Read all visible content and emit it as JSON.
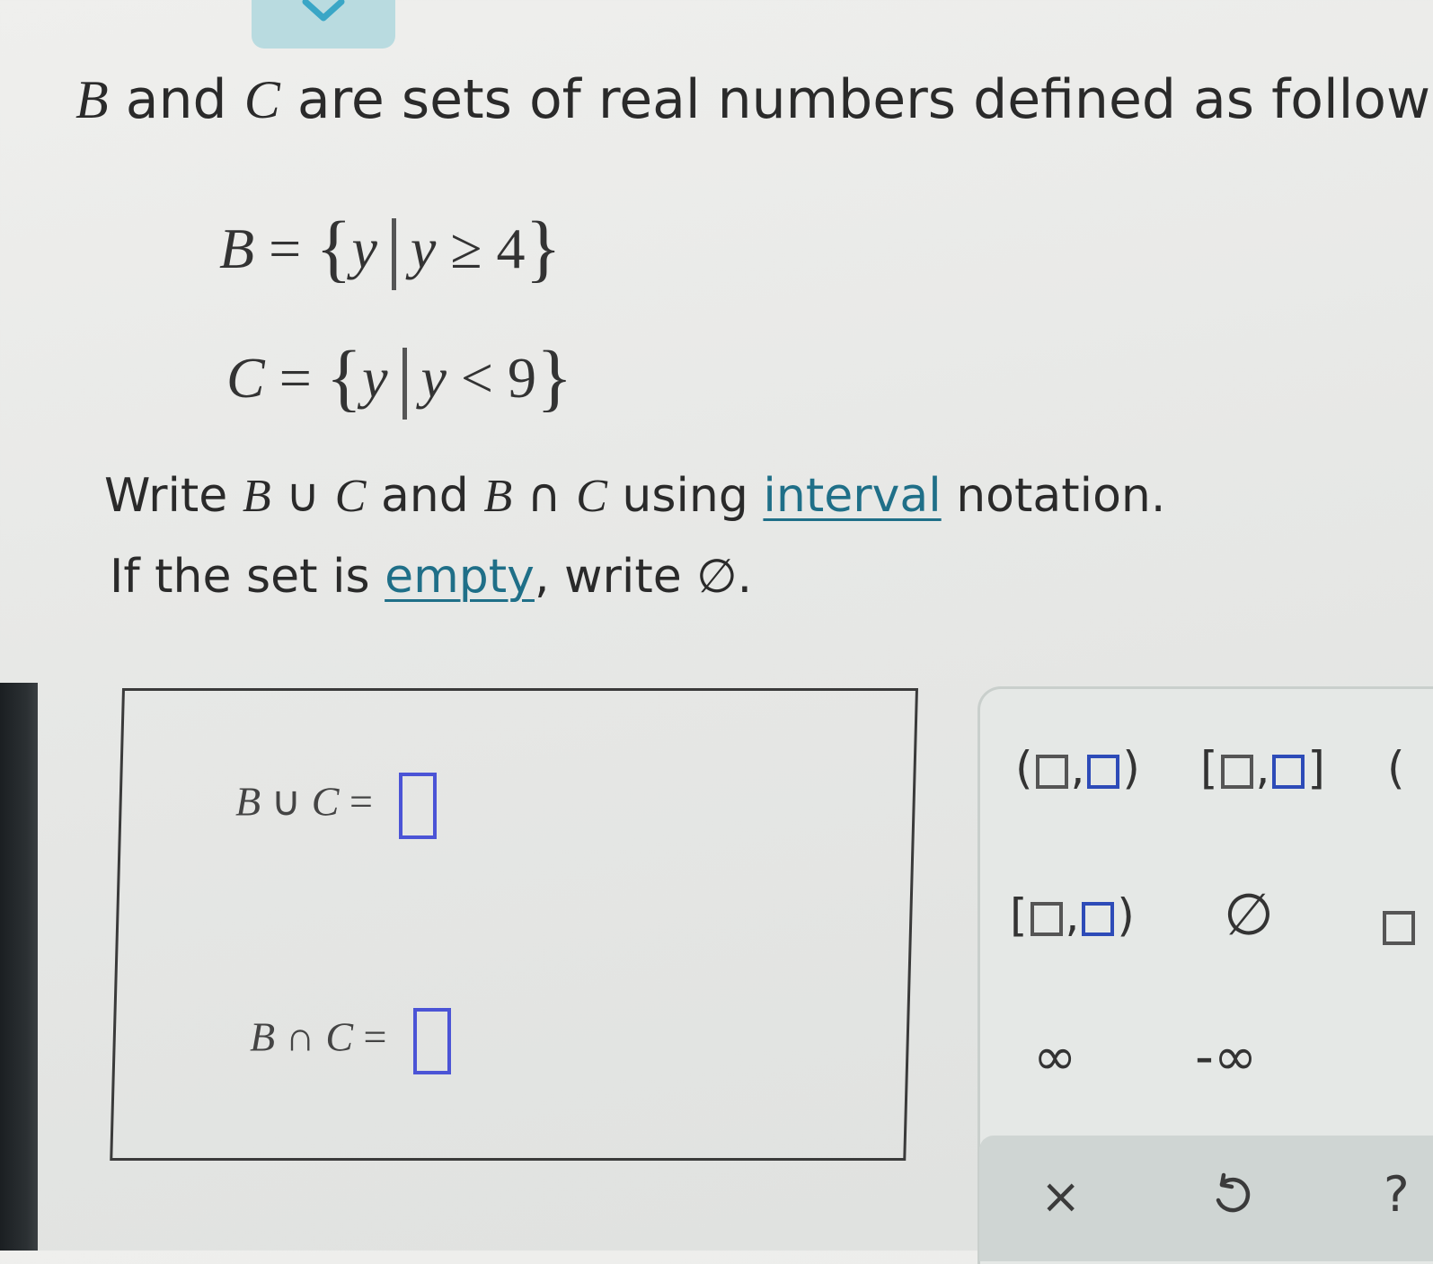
{
  "top_tab": {
    "icon": "chevron-down-icon"
  },
  "problem": {
    "intro_text": "are sets of real numbers defined as follows.",
    "var_b": "B",
    "var_c": "C",
    "and_word": "and",
    "set_b": {
      "lhs": "B",
      "eq": "=",
      "lbrace": "{",
      "var": "y",
      "cond_var": "y",
      "op": "≥",
      "value": "4",
      "rbrace": "}"
    },
    "set_c": {
      "lhs": "C",
      "eq": "=",
      "lbrace": "{",
      "var": "y",
      "cond_var": "y",
      "op": "<",
      "value": "9",
      "rbrace": "}"
    }
  },
  "instructions": {
    "write": "Write",
    "union": "∪",
    "intersect": "∩",
    "and": "and",
    "using": "using",
    "interval_link": "interval",
    "notation": "notation.",
    "empty_prefix": "If the set is",
    "empty_link": "empty",
    "empty_suffix": ", write ∅."
  },
  "answers": {
    "union_label": {
      "b": "B",
      "op": "∪",
      "c": "C",
      "eq": "="
    },
    "intersect_label": {
      "b": "B",
      "op": "∩",
      "c": "C",
      "eq": "="
    }
  },
  "keypad": {
    "open_open": {
      "left": "(",
      "comma": ",",
      "right": ")"
    },
    "closed_closed": {
      "left": "[",
      "comma": ",",
      "right": "]"
    },
    "open_cut": "(",
    "closed_open": {
      "left": "[",
      "comma": ",",
      "right": ")"
    },
    "empty_set": "∅",
    "infinity": "∞",
    "neg_infinity": "-∞",
    "clear": "×",
    "undo_icon": "undo-icon",
    "help": "?"
  },
  "colors": {
    "accent_blue": "#4b54d6",
    "link": "#1f6f88",
    "tab": "#b9dbe0"
  }
}
